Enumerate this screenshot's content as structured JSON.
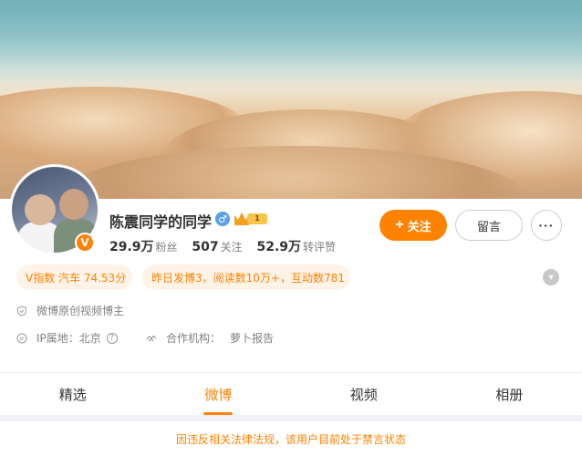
{
  "profile": {
    "name": "陈震同学的同学",
    "gender_symbol": "♂",
    "vip_level": "1",
    "verified_badge": "V",
    "stats": [
      {
        "value": "29.9万",
        "label": "粉丝"
      },
      {
        "value": "507",
        "label": "关注"
      },
      {
        "value": "52.9万",
        "label": "转评赞"
      }
    ]
  },
  "actions": {
    "follow_plus": "+",
    "follow_label": "关注",
    "message_label": "留言",
    "more_label": "···"
  },
  "tags": {
    "vindex": "V指数 汽车 74.53分",
    "activity": "昨日发博3，阅读数10万+，互动数781"
  },
  "info": {
    "creator": "微博原创视频博主",
    "ip_label": "IP属地：北京",
    "partner_label": "合作机构：",
    "partner_name": "萝卜报告"
  },
  "tabs": [
    {
      "label": "精选"
    },
    {
      "label": "微博"
    },
    {
      "label": "视频"
    },
    {
      "label": "相册"
    }
  ],
  "active_tab": "微博",
  "notice": "因违反相关法律法规，该用户目前处于禁言状态",
  "colors": {
    "accent": "#ff8200",
    "tag_bg": "#fff3e8",
    "gender": "#5aa0e6"
  },
  "icons": [
    "shield-icon",
    "ip-location-icon",
    "partner-icon",
    "question-icon",
    "chevron-down-icon",
    "crown-icon"
  ]
}
